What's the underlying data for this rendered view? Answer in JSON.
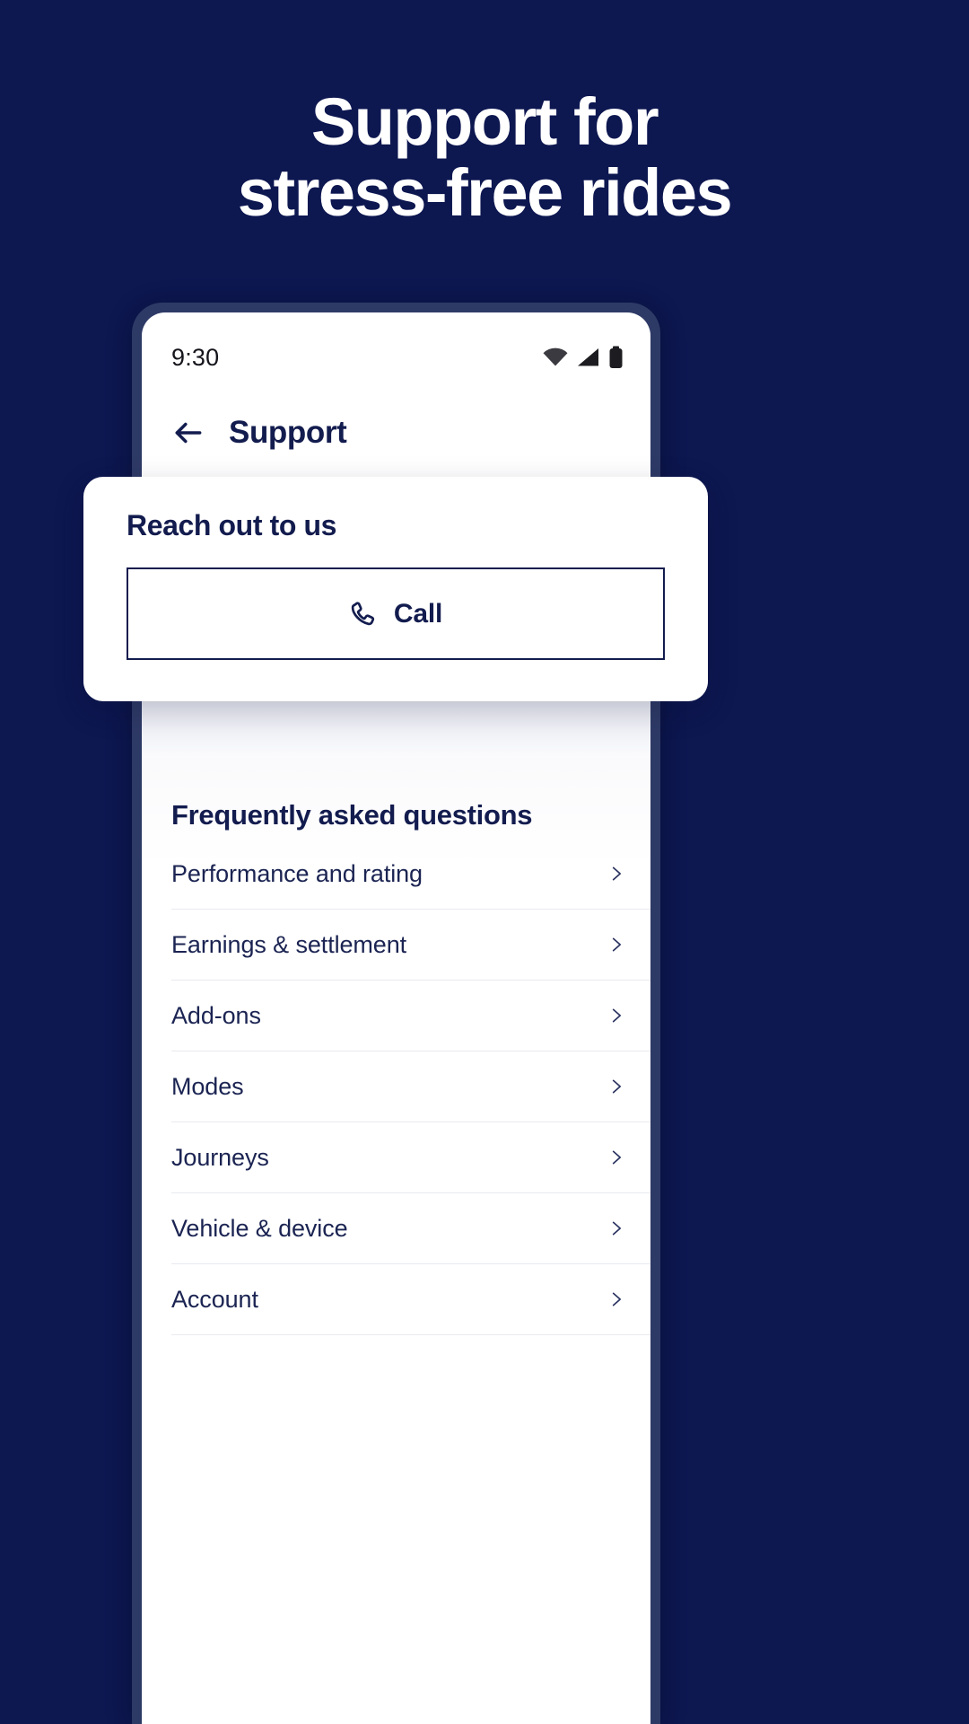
{
  "hero": {
    "line1": "Support for",
    "line2": "stress-free rides"
  },
  "phone": {
    "statusbar": {
      "time": "9:30",
      "icons": [
        "wifi-icon",
        "signal-icon",
        "battery-icon"
      ]
    },
    "header": {
      "back_icon": "back-arrow-icon",
      "title": "Support"
    }
  },
  "reach_card": {
    "title": "Reach out to us",
    "call_button": {
      "label": "Call",
      "icon": "phone-handset-icon"
    }
  },
  "faq": {
    "title": "Frequently asked questions",
    "items": [
      {
        "label": "Performance and rating"
      },
      {
        "label": "Earnings & settlement"
      },
      {
        "label": "Add-ons"
      },
      {
        "label": "Modes"
      },
      {
        "label": "Journeys"
      },
      {
        "label": "Vehicle & device"
      },
      {
        "label": "Account"
      }
    ],
    "chevron_icon": "chevron-right-icon"
  },
  "colors": {
    "background": "#0d1750",
    "phone_bezel": "#2e3a66",
    "navy_text": "#131c4e",
    "divider": "#e9eaf0"
  }
}
